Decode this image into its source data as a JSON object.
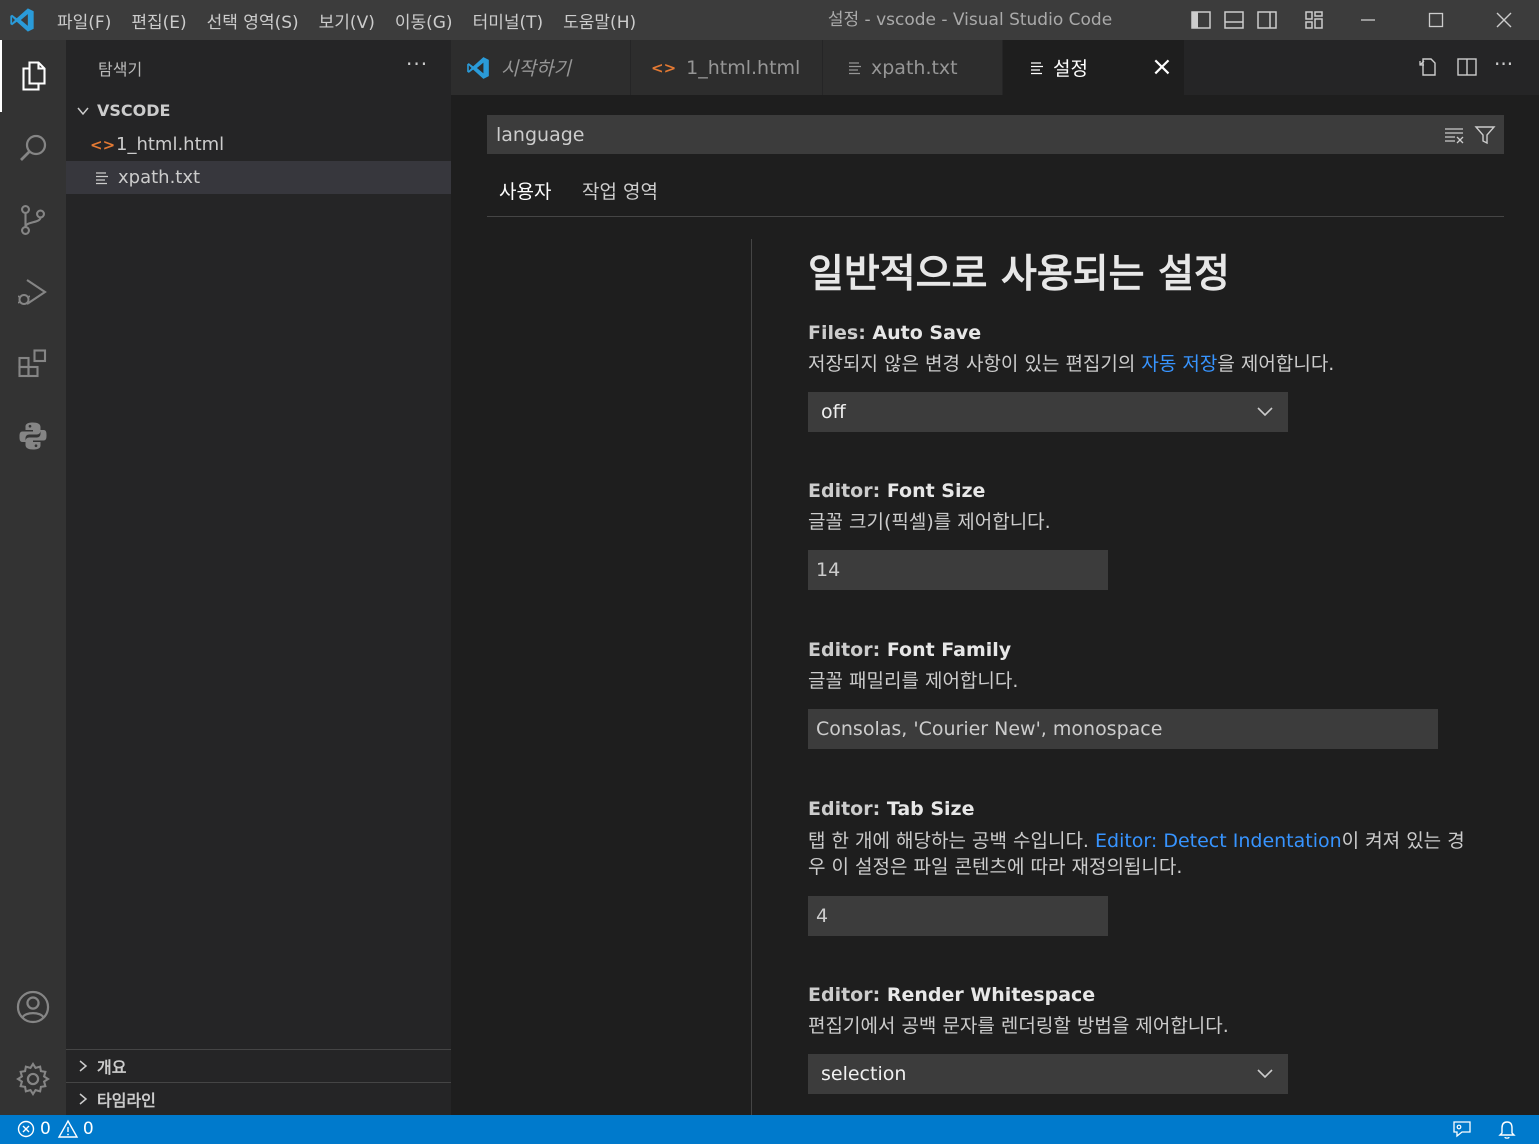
{
  "menu": [
    "파일(F)",
    "편집(E)",
    "선택 영역(S)",
    "보기(V)",
    "이동(G)",
    "터미널(T)",
    "도움말(H)"
  ],
  "window_title": "설정 - vscode - Visual Studio Code",
  "sidebar": {
    "header": "탐색기",
    "more": "···",
    "folder": "VSCODE",
    "files": [
      {
        "icon": "html-file-icon",
        "name": "1_html.html"
      },
      {
        "icon": "text-file-icon",
        "name": "xpath.txt"
      }
    ],
    "sections": [
      "개요",
      "타임라인"
    ]
  },
  "tabs": [
    {
      "label": "시작하기",
      "icon": "vscode-logo-icon"
    },
    {
      "label": "1_html.html",
      "icon": "html-file-icon"
    },
    {
      "label": "xpath.txt",
      "icon": "text-file-icon"
    },
    {
      "label": "설정",
      "icon": "settings-file-icon",
      "close": "×"
    }
  ],
  "settings": {
    "search_value": "language",
    "scope_tabs": [
      "사용자",
      "작업 영역"
    ],
    "section_title": "일반적으로 사용되는 설정",
    "items": [
      {
        "category": "Files: ",
        "name": "Auto Save",
        "desc_before": "저장되지 않은 변경 사항이 있는 편집기의 ",
        "desc_link": "자동 저장",
        "desc_after": "을 제어합니다.",
        "value": "off"
      },
      {
        "category": "Editor: ",
        "name": "Font Size",
        "desc": "글꼴 크기(픽셀)를 제어합니다.",
        "value": "14"
      },
      {
        "category": "Editor: ",
        "name": "Font Family",
        "desc": "글꼴 패밀리를 제어합니다.",
        "value": "Consolas, 'Courier New', monospace"
      },
      {
        "category": "Editor: ",
        "name": "Tab Size",
        "desc_before": "탭 한 개에 해당하는 공백 수입니다. ",
        "desc_link": "Editor: Detect Indentation",
        "desc_after": "이 켜져 있는 경우 이 설정은 파일 콘텐츠에 따라 재정의됩니다.",
        "value": "4"
      },
      {
        "category": "Editor: ",
        "name": "Render Whitespace",
        "desc": "편집기에서 공백 문자를 렌더링할 방법을 제어합니다.",
        "value": "selection"
      }
    ]
  },
  "status": {
    "errors": "0",
    "warnings": "0"
  },
  "colors": {
    "accent": "#007acc",
    "link": "#3794ff",
    "html_icon": "#e37933"
  }
}
